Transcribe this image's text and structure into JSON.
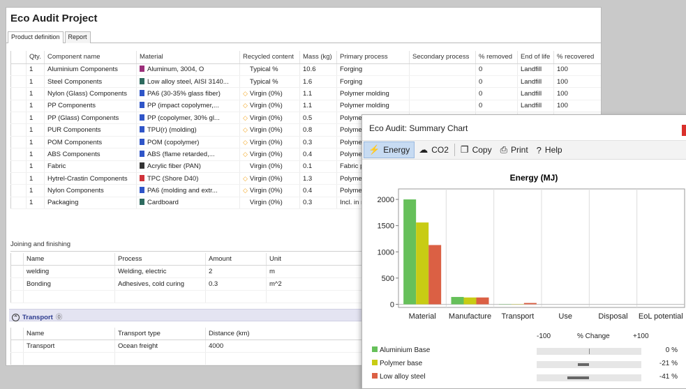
{
  "window_title": "Eco Audit Project",
  "tabs": [
    "Product definition",
    "Report"
  ],
  "components": {
    "headers": [
      "",
      "Qty.",
      "Component name",
      "Material",
      "Recycled content",
      "Mass (kg)",
      "Primary process",
      "Secondary process",
      "% removed",
      "End of life",
      "% recovered"
    ],
    "rows": [
      {
        "qty": "1",
        "name": "Aluminium Components",
        "mat_color": "#9b2f7a",
        "material": "Aluminum, 3004, O",
        "warn": false,
        "recycled": "Typical %",
        "mass": "10.6",
        "primary": "Forging",
        "secondary": "",
        "removed": "0",
        "eol": "Landfill",
        "recovered": "100"
      },
      {
        "qty": "1",
        "name": "Steel Components",
        "mat_color": "#2e6b5f",
        "material": "Low alloy steel, AISI 3140...",
        "warn": false,
        "recycled": "Typical %",
        "mass": "1.6",
        "primary": "Forging",
        "secondary": "",
        "removed": "0",
        "eol": "Landfill",
        "recovered": "100"
      },
      {
        "qty": "1",
        "name": "Nylon (Glass) Components",
        "mat_color": "#2f55c8",
        "material": "PA6 (30-35% glass fiber)",
        "warn": true,
        "recycled": "Virgin (0%)",
        "mass": "1.1",
        "primary": "Polymer molding",
        "secondary": "",
        "removed": "0",
        "eol": "Landfill",
        "recovered": "100"
      },
      {
        "qty": "1",
        "name": "PP Components",
        "mat_color": "#2f55c8",
        "material": "PP (impact copolymer,...",
        "warn": true,
        "recycled": "Virgin (0%)",
        "mass": "1.1",
        "primary": "Polymer molding",
        "secondary": "",
        "removed": "0",
        "eol": "Landfill",
        "recovered": "100"
      },
      {
        "qty": "1",
        "name": "PP (Glass) Components",
        "mat_color": "#2f55c8",
        "material": "PP (copolymer, 30% gl...",
        "warn": true,
        "recycled": "Virgin (0%)",
        "mass": "0.5",
        "primary": "Polymer",
        "secondary": "",
        "removed": "",
        "eol": "",
        "recovered": ""
      },
      {
        "qty": "1",
        "name": "PUR Components",
        "mat_color": "#2f55c8",
        "material": "TPU(r) (molding)",
        "warn": true,
        "recycled": "Virgin (0%)",
        "mass": "0.8",
        "primary": "Polymer",
        "secondary": "",
        "removed": "",
        "eol": "",
        "recovered": ""
      },
      {
        "qty": "1",
        "name": "POM Components",
        "mat_color": "#2f55c8",
        "material": "POM (copolymer)",
        "warn": true,
        "recycled": "Virgin (0%)",
        "mass": "0.3",
        "primary": "Polymer",
        "secondary": "",
        "removed": "",
        "eol": "",
        "recovered": ""
      },
      {
        "qty": "1",
        "name": "ABS Components",
        "mat_color": "#2f55c8",
        "material": "ABS (flame retarded,...",
        "warn": true,
        "recycled": "Virgin (0%)",
        "mass": "0.4",
        "primary": "Polymer",
        "secondary": "",
        "removed": "",
        "eol": "",
        "recovered": ""
      },
      {
        "qty": "1",
        "name": "Fabric",
        "mat_color": "#333333",
        "material": "Acrylic fiber (PAN)",
        "warn": false,
        "recycled": "Virgin (0%)",
        "mass": "0.1",
        "primary": "Fabric p",
        "secondary": "",
        "removed": "",
        "eol": "",
        "recovered": ""
      },
      {
        "qty": "1",
        "name": "Hytrel-Crastin Components",
        "mat_color": "#d0323a",
        "material": "TPC (Shore D40)",
        "warn": true,
        "recycled": "Virgin (0%)",
        "mass": "1.3",
        "primary": "Polymer",
        "secondary": "",
        "removed": "",
        "eol": "",
        "recovered": ""
      },
      {
        "qty": "1",
        "name": "Nylon Components",
        "mat_color": "#2f55c8",
        "material": "PA6 (molding and extr...",
        "warn": true,
        "recycled": "Virgin (0%)",
        "mass": "0.4",
        "primary": "Polymer",
        "secondary": "",
        "removed": "",
        "eol": "",
        "recovered": ""
      },
      {
        "qty": "1",
        "name": "Packaging",
        "mat_color": "#2e6b5f",
        "material": "Cardboard",
        "warn": false,
        "recycled": "Virgin (0%)",
        "mass": "0.3",
        "primary": "Incl. in m",
        "secondary": "",
        "removed": "",
        "eol": "",
        "recovered": ""
      }
    ]
  },
  "joining": {
    "title": "Joining and finishing",
    "headers": [
      "",
      "Name",
      "Process",
      "Amount",
      "Unit"
    ],
    "rows": [
      {
        "name": "welding",
        "process": "Welding, electric",
        "amount": "2",
        "unit": "m"
      },
      {
        "name": "Bonding",
        "process": "Adhesives, cold curing",
        "amount": "0.3",
        "unit": "m^2"
      }
    ]
  },
  "transport": {
    "title": "Transport",
    "headers": [
      "",
      "Name",
      "Transport type",
      "Distance (km)"
    ],
    "rows": [
      {
        "name": "Transport",
        "type": "Ocean freight",
        "distance": "4000"
      }
    ]
  },
  "chart_window": {
    "title": "Eco Audit: Summary Chart",
    "toolbar": [
      {
        "label": "Energy",
        "icon": "energy-icon",
        "active": true
      },
      {
        "label": "CO2",
        "icon": "co2-icon",
        "active": false
      },
      {
        "label": "Copy",
        "icon": "copy-icon",
        "active": false
      },
      {
        "label": "Print",
        "icon": "print-icon",
        "active": false
      },
      {
        "label": "Help",
        "icon": "help-icon",
        "active": false
      }
    ],
    "percent_change": {
      "label": "% Change",
      "axis_labels": [
        "-100",
        "+100"
      ],
      "rows": [
        {
          "name": "Aluminium Base",
          "color": "#66c05a",
          "value": "0 %",
          "pct": 0
        },
        {
          "name": "Polymer base",
          "color": "#c8cc14",
          "value": "-21 %",
          "pct": -21
        },
        {
          "name": "Low alloy steel",
          "color": "#db6044",
          "value": "-41 %",
          "pct": -41
        }
      ]
    }
  },
  "chart_data": {
    "type": "bar",
    "title": "Energy (MJ)",
    "xlabel": "",
    "ylabel": "",
    "categories": [
      "Material",
      "Manufacture",
      "Transport",
      "Use",
      "Disposal",
      "EoL potential"
    ],
    "series": [
      {
        "name": "Aluminium Base",
        "color": "#66c05a",
        "values": [
          2000,
          140,
          5,
          0,
          0,
          0
        ]
      },
      {
        "name": "Polymer base",
        "color": "#c8cc14",
        "values": [
          1560,
          130,
          5,
          0,
          0,
          0
        ]
      },
      {
        "name": "Low alloy steel",
        "color": "#db6044",
        "values": [
          1130,
          130,
          25,
          0,
          0,
          0
        ]
      }
    ],
    "yticks": [
      0,
      500,
      1000,
      1500,
      2000
    ],
    "ylim": [
      -60,
      2200
    ],
    "grid": true
  }
}
